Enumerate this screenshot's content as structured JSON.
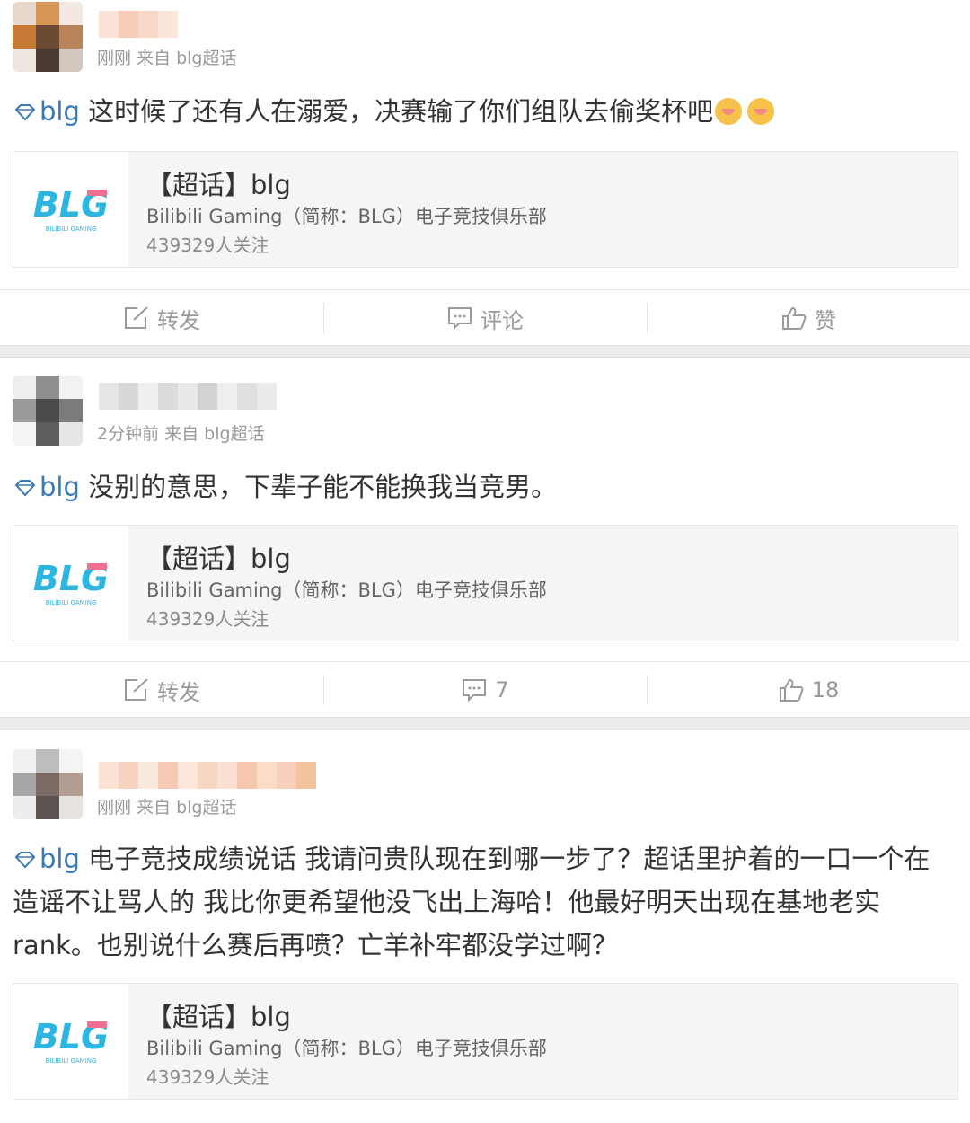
{
  "posts": [
    {
      "meta": "刚刚 来自 blg超话",
      "tag": "blg",
      "text": " 这时候了还有人在溺爱，决赛输了你们组队去偷奖杯吧",
      "emoji_count": 2,
      "card": {
        "title": "【超话】blg",
        "desc": "Bilibili Gaming（简称：BLG）电子竞技俱乐部",
        "follow": "439329人关注",
        "logo_text": "BLG",
        "logo_subtext": "BILIBILI GAMING"
      },
      "actions": {
        "repost": "转发",
        "comment": "评论",
        "like": "赞"
      }
    },
    {
      "meta": "2分钟前 来自 blg超话",
      "tag": "blg",
      "text": " 没别的意思，下辈子能不能换我当竞男。",
      "card": {
        "title": "【超话】blg",
        "desc": "Bilibili Gaming（简称：BLG）电子竞技俱乐部",
        "follow": "439329人关注",
        "logo_text": "BLG",
        "logo_subtext": "BILIBILI GAMING"
      },
      "actions": {
        "repost": "转发",
        "comment": "7",
        "like": "18"
      }
    },
    {
      "meta": "刚刚 来自 blg超话",
      "tag": "blg",
      "text": " 电子竞技成绩说话 我请问贵队现在到哪一步了？超话里护着的一口一个在造谣不让骂人的 我比你更希望他没飞出上海哈！他最好明天出现在基地老实rank。也别说什么赛后再喷？亡羊补牢都没学过啊？",
      "card": {
        "title": "【超话】blg",
        "desc": "Bilibili Gaming（简称：BLG）电子竞技俱乐部",
        "follow": "439329人关注",
        "logo_text": "BLG",
        "logo_subtext": "BILIBILI GAMING"
      }
    }
  ],
  "colors": {
    "tag": "#3a79b8",
    "logo_cyan": "#2bb5e0",
    "logo_pink": "#f06f93",
    "muted": "#999999"
  },
  "icons": [
    "tag-diamond-icon",
    "repost-icon",
    "comment-icon",
    "like-icon",
    "emoji-icon"
  ]
}
